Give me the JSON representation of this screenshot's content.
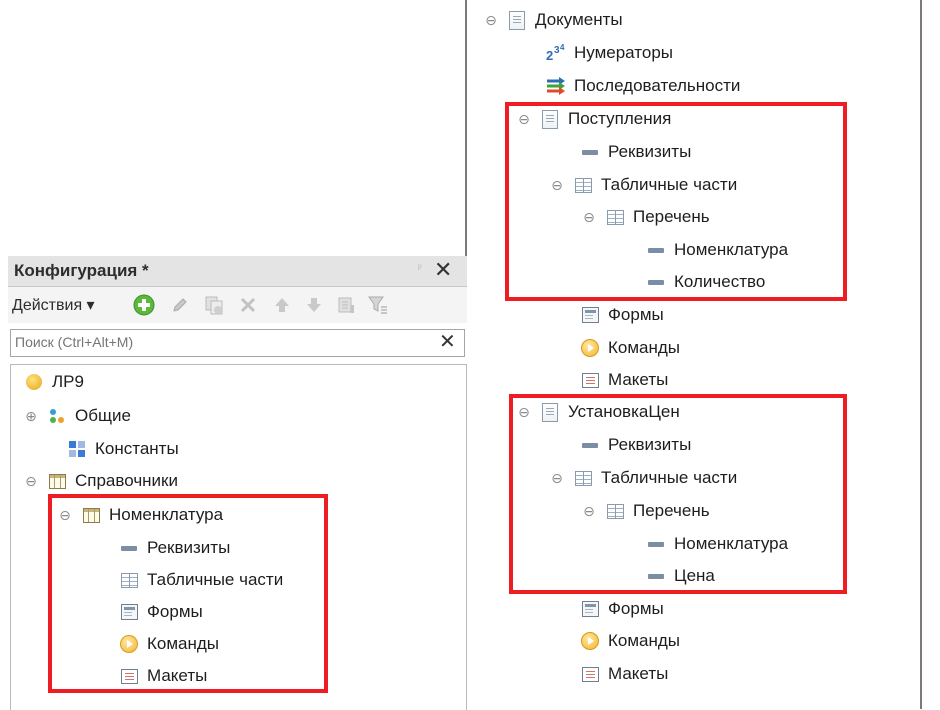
{
  "panel": {
    "title": "Конфигурация *",
    "pin_glyph": "ᵖ",
    "close_glyph": "✕",
    "toolbar": {
      "actions_label": "Действия ▾",
      "icons": [
        "add-icon",
        "edit-icon",
        "copy-icon",
        "delete-icon",
        "move-up-icon",
        "move-down-icon",
        "sort-icon",
        "filter-icon"
      ]
    },
    "search": {
      "placeholder": "Поиск (Ctrl+Alt+M)",
      "clear_glyph": "✕"
    }
  },
  "left_tree": {
    "root": "ЛР9",
    "common": "Общие",
    "constants": "Константы",
    "catalogs": "Справочники",
    "catalog_item": "Номенклатура",
    "requisites": "Реквизиты",
    "tabular": "Табличные части",
    "forms": "Формы",
    "commands": "Команды",
    "templates": "Макеты"
  },
  "right_tree": {
    "documents": "Документы",
    "numerators": "Нумераторы",
    "sequences": "Последовательности",
    "doc1": {
      "name": "Поступления",
      "requisites": "Реквизиты",
      "tabular": "Табличные части",
      "table": "Перечень",
      "field1": "Номенклатура",
      "field2": "Количество",
      "forms": "Формы",
      "commands": "Команды",
      "templates": "Макеты"
    },
    "doc2": {
      "name": "УстановкаЦен",
      "requisites": "Реквизиты",
      "tabular": "Табличные части",
      "table": "Перечень",
      "field1": "Номенклатура",
      "field2": "Цена",
      "forms": "Формы",
      "commands": "Команды",
      "templates": "Макеты"
    }
  },
  "glyphs": {
    "collapse": "⊖",
    "expand": "⊕"
  },
  "colors": {
    "highlight": "#ee1c23",
    "title_bar": "#e4e4e4"
  }
}
